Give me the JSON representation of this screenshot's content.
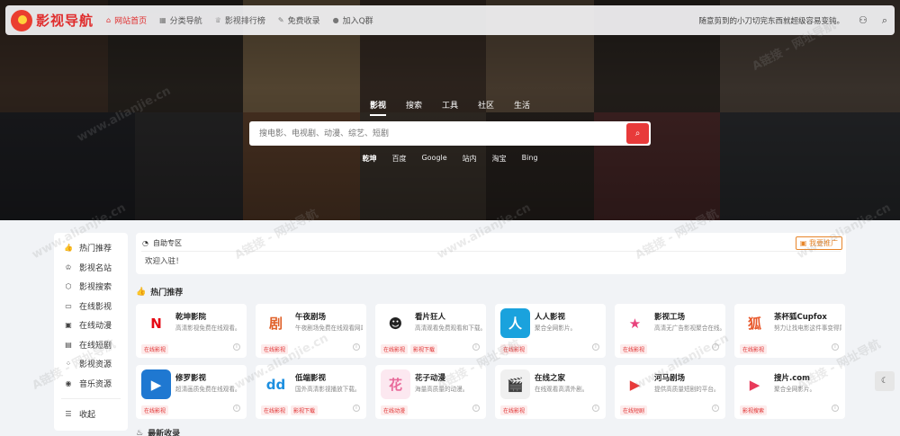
{
  "header": {
    "logo_text": "影视导航",
    "nav": [
      {
        "label": "网站首页",
        "icon": "home-icon"
      },
      {
        "label": "分类导航",
        "icon": "grid-icon"
      },
      {
        "label": "影视排行榜",
        "icon": "trophy-icon"
      },
      {
        "label": "免费收录",
        "icon": "edit-icon"
      },
      {
        "label": "加入Q群",
        "icon": "penguin-icon"
      }
    ],
    "ticker": "随意剪到的小刀切完东西就超级容易变钝。",
    "user_icon": "user-icon",
    "search_icon": "search-icon"
  },
  "search": {
    "tabs": [
      "影视",
      "搜索",
      "工具",
      "社区",
      "生活"
    ],
    "placeholder": "搜电影、电视剧、动漫、综艺、短剧",
    "engines": [
      "乾坤",
      "百度",
      "Google",
      "站内",
      "淘宝",
      "Bing"
    ]
  },
  "sidebar": {
    "items": [
      {
        "label": "热门推荐",
        "icon": "thumbs-up-icon"
      },
      {
        "label": "影视名站",
        "icon": "crown-icon"
      },
      {
        "label": "影视搜索",
        "icon": "cube-icon"
      },
      {
        "label": "在线影视",
        "icon": "monitor-icon"
      },
      {
        "label": "在线动漫",
        "icon": "tv-icon"
      },
      {
        "label": "在线短剧",
        "icon": "film-icon"
      },
      {
        "label": "影视资源",
        "icon": "apps-icon"
      },
      {
        "label": "音乐资源",
        "icon": "record-icon"
      }
    ],
    "collapse_label": "收起"
  },
  "notice": {
    "title": "自助专区",
    "body": "欢迎入驻！",
    "apply_label": "我要推广"
  },
  "hot_section_title": "热门推荐",
  "latest_section_title": "最新收录",
  "cards_row1": [
    {
      "title": "乾坤影院",
      "desc": "高清影视免费在线观看。",
      "tags": [
        "在线影视"
      ],
      "logo_bg": "#ffffff",
      "logo_fg": "#e50914",
      "logo_char": "N"
    },
    {
      "title": "午夜剧场",
      "desc": "午夜剧场免费在线观看网站。",
      "tags": [
        "在线影视"
      ],
      "logo_bg": "#ffffff",
      "logo_fg": "#e0612a",
      "logo_char": "剧"
    },
    {
      "title": "看片狂人",
      "desc": "高清观看免费观看和下载。",
      "tags": [
        "在线影视",
        "影视下载"
      ],
      "logo_bg": "#ffffff",
      "logo_fg": "#222222",
      "logo_char": "☻"
    },
    {
      "title": "人人影视",
      "desc": "聚合全网影片。",
      "tags": [
        "在线影视"
      ],
      "logo_bg": "#1aa2dd",
      "logo_fg": "#ffffff",
      "logo_char": "人"
    },
    {
      "title": "影视工场",
      "desc": "高清无广告影视聚合在线。",
      "tags": [
        "在线影视"
      ],
      "logo_bg": "#ffffff",
      "logo_fg": "#e8427c",
      "logo_char": "★"
    },
    {
      "title": "茶杯狐Cupfox",
      "desc": "努力让找电影这件事变得简单。",
      "tags": [
        "在线影视"
      ],
      "logo_bg": "#ffffff",
      "logo_fg": "#e8572a",
      "logo_char": "狐"
    }
  ],
  "cards_row2": [
    {
      "title": "修罗影视",
      "desc": "超清画质免费在线观看。",
      "tags": [
        "在线影视"
      ],
      "logo_bg": "#1f78d1",
      "logo_fg": "#ffffff",
      "logo_char": "▶"
    },
    {
      "title": "低端影视",
      "desc": "国外高清影视播放下载。",
      "tags": [
        "在线影视",
        "影视下载"
      ],
      "logo_bg": "#ffffff",
      "logo_fg": "#1d8fe0",
      "logo_char": "dd"
    },
    {
      "title": "花子动漫",
      "desc": "海量高质量的动漫。",
      "tags": [
        "在线动漫"
      ],
      "logo_bg": "#fce8f0",
      "logo_fg": "#e86a9a",
      "logo_char": "花"
    },
    {
      "title": "在线之家",
      "desc": "在线观看高清外剧。",
      "tags": [
        "在线影视"
      ],
      "logo_bg": "#f0f0f0",
      "logo_fg": "#222222",
      "logo_char": "🎬"
    },
    {
      "title": "河马剧场",
      "desc": "提供高质量短剧的平台。",
      "tags": [
        "在线短剧"
      ],
      "logo_bg": "#ffffff",
      "logo_fg": "#e83a3a",
      "logo_char": "▶"
    },
    {
      "title": "搜片.com",
      "desc": "聚合全网影片。",
      "tags": [
        "影视搜索"
      ],
      "logo_bg": "#ffffff",
      "logo_fg": "#e83a5a",
      "logo_char": "▶"
    }
  ],
  "watermark_text": "A链接 - 网址导航",
  "watermark_url": "www.alianjie.cn",
  "float_button_icon": "moon-icon",
  "colors": {
    "accent": "#e83a3a",
    "page_bg": "#f1f3f6"
  }
}
